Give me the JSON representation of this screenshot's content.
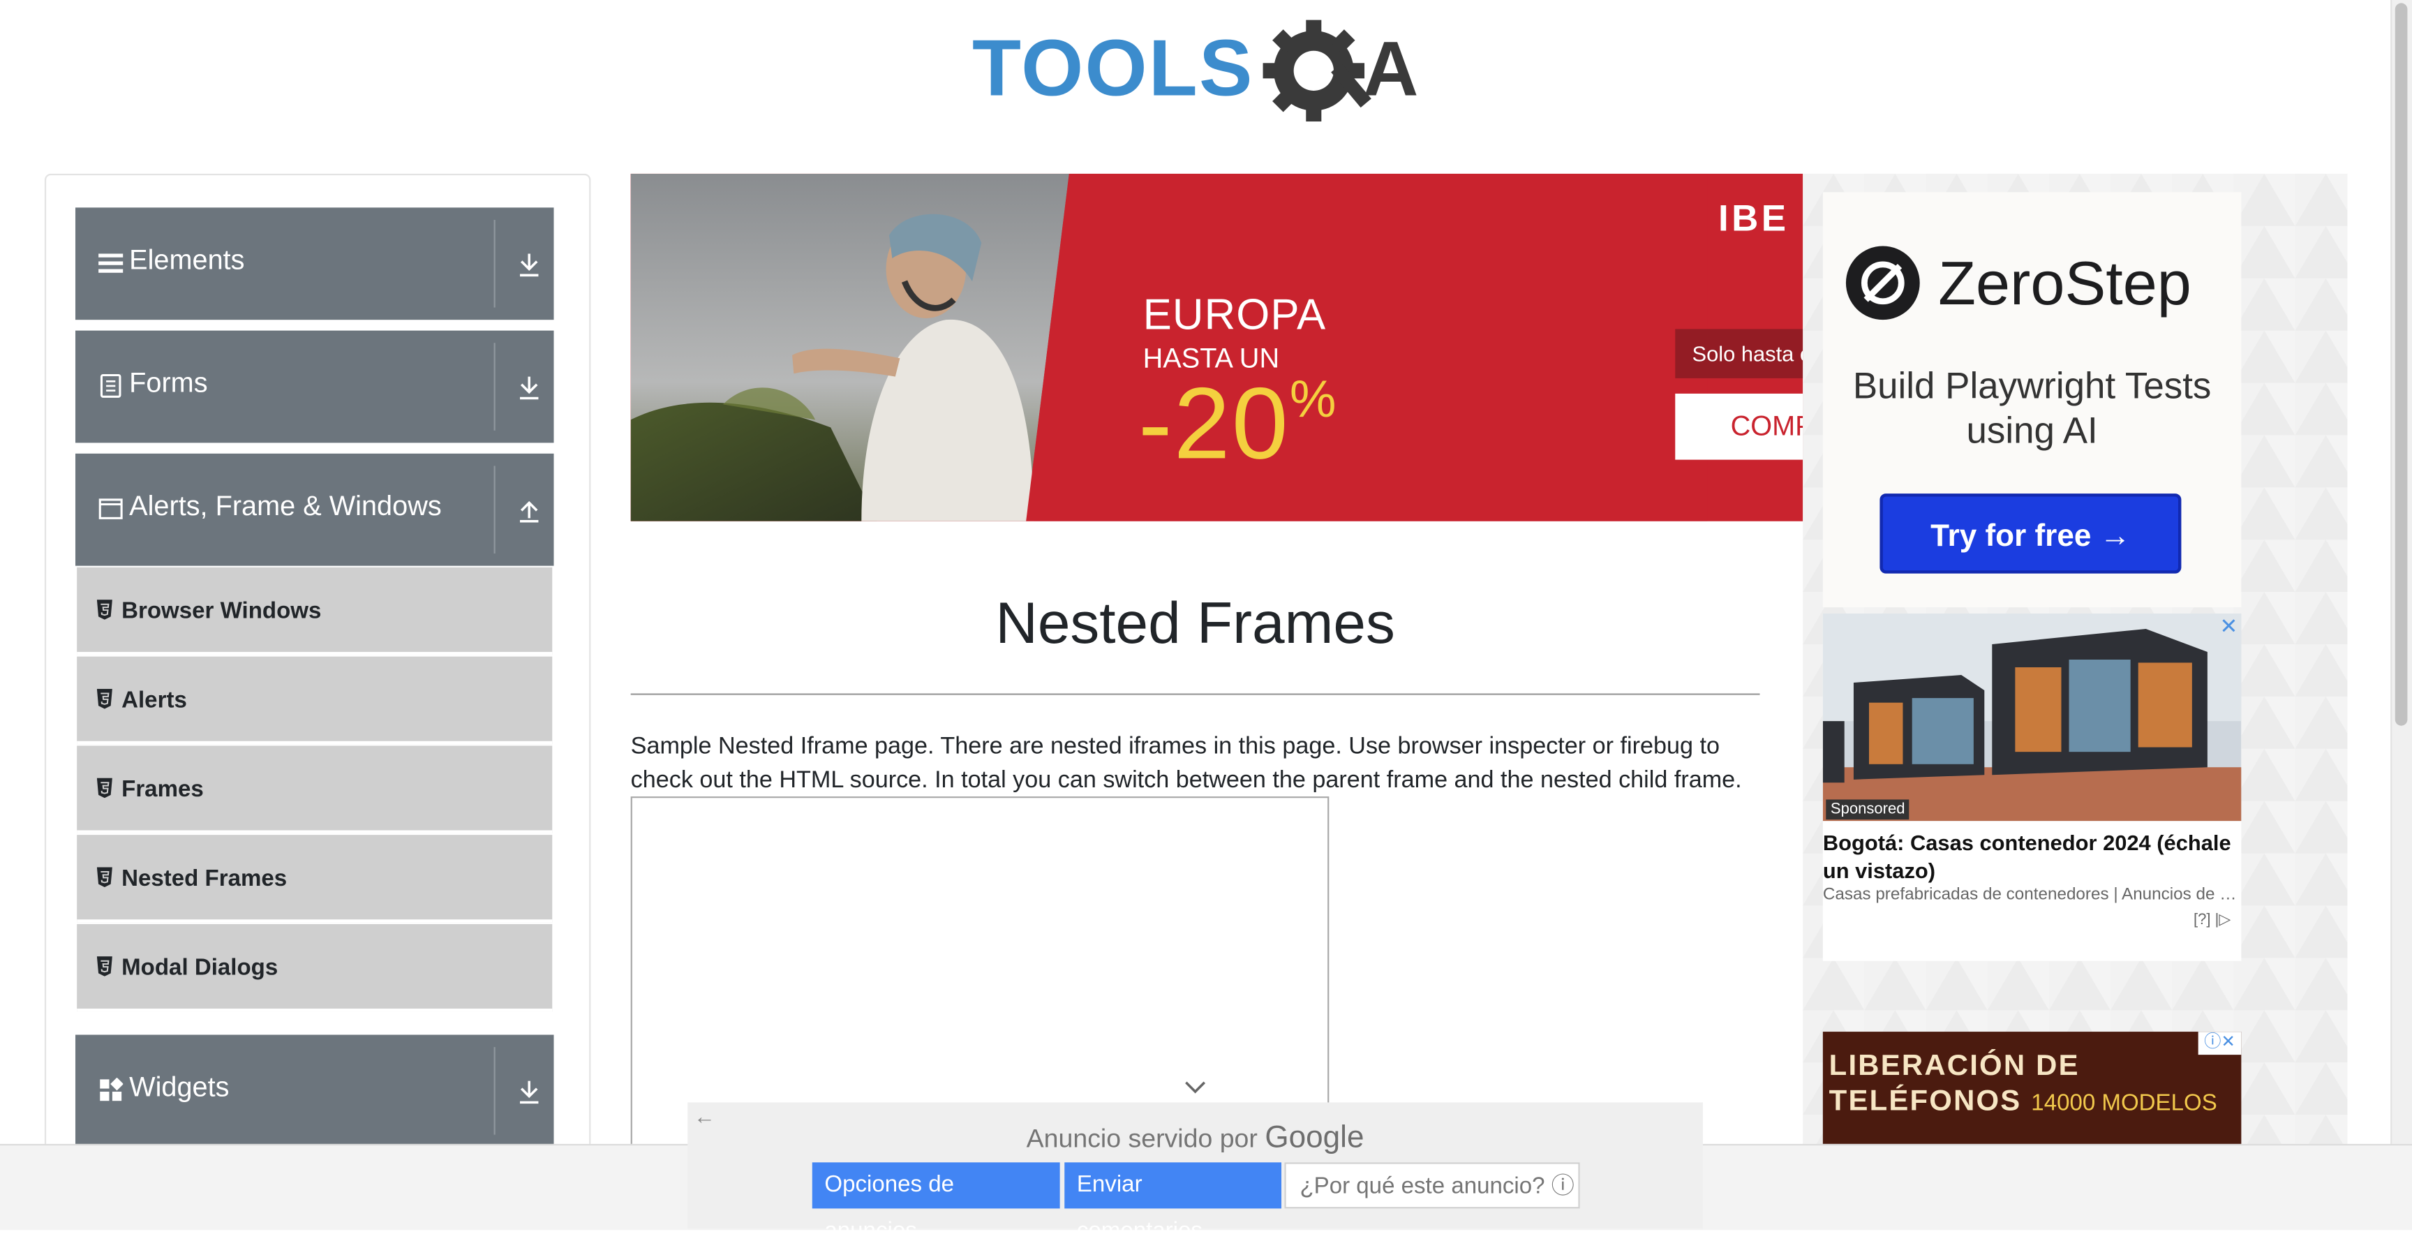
{
  "logo": {
    "text_tools": "TOOLS",
    "text_qa": "QA"
  },
  "sidebar": {
    "groups": [
      {
        "label": "Elements",
        "icon": "hamburger-icon",
        "arrow": "download-arrow-icon"
      },
      {
        "label": "Forms",
        "icon": "form-icon",
        "arrow": "download-arrow-icon"
      },
      {
        "label": "Alerts, Frame & Windows",
        "icon": "window-icon",
        "arrow": "upload-arrow-icon"
      },
      {
        "label": "Widgets",
        "icon": "widgets-icon",
        "arrow": "download-arrow-icon"
      }
    ],
    "alerts_items": [
      {
        "label": "Browser Windows"
      },
      {
        "label": "Alerts"
      },
      {
        "label": "Frames"
      },
      {
        "label": "Nested Frames"
      },
      {
        "label": "Modal Dialogs"
      }
    ]
  },
  "banner": {
    "brand": "IBE",
    "line1": "EUROPA",
    "line2": "HASTA UN",
    "pct": "-20",
    "pct_sign": "%",
    "tag": "Solo hasta e",
    "cta": "COMP"
  },
  "main": {
    "title": "Nested Frames",
    "description": "Sample Nested Iframe page. There are nested iframes in this page. Use browser inspecter or firebug to check out the HTML source. In total you can switch between the parent frame and the nested child frame."
  },
  "ads": {
    "zerostep": {
      "name": "ZeroStep",
      "tagline": "Build Playwright Tests using AI",
      "button": "Try for free →"
    },
    "sponsored": {
      "badge": "Sponsored",
      "close": "✕",
      "title": "Bogotá: Casas contenedor 2024 (échale un vistazo)",
      "subtitle": "Casas prefabricadas de contenedores | Anuncios de b...",
      "ad_marker": "[?] |▷"
    },
    "liberacion": {
      "line1": "LIBERACIÓN DE",
      "line2": "TELÉFONOS",
      "line2b": "14000 MODELOS",
      "info": "ⓘ✕"
    }
  },
  "ad_footer": {
    "back": "←",
    "served_prefix": "Anuncio servido por",
    "served_brand": "Google",
    "options": "Opciones de anuncios",
    "feedback": "Enviar comentarios",
    "why": "¿Por qué este anuncio? ⓘ"
  },
  "colors": {
    "sidebar_group": "#6c757d",
    "sidebar_item": "#cfcfcf",
    "banner_red": "#c9232e",
    "ad_blue": "#4285f4"
  }
}
